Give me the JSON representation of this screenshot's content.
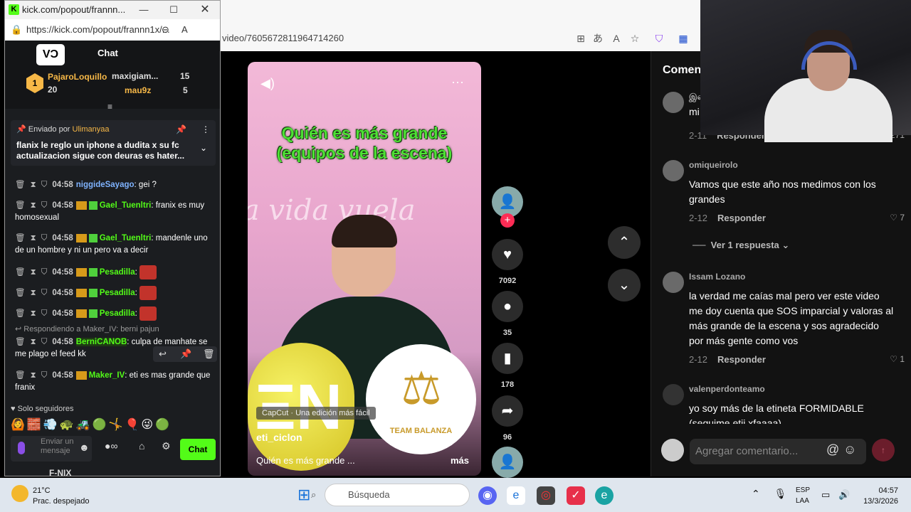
{
  "browser": {
    "url_fragment": "video/7605672811964714260"
  },
  "video": {
    "title_line1": "Quién es más grande",
    "title_line2": "(equipos de la escena)",
    "cursive_text": "la vida vuela",
    "capcut": "CapCut · Una edición más fácil",
    "author": "eti_ciclon",
    "description": "Quién es más grande ...",
    "more": "más",
    "logo_text": "TEAM BALANZA",
    "mute_icon": "speaker-icon",
    "more_icon": "ellipsis-icon"
  },
  "actions": {
    "likes": "7092",
    "comments": "35",
    "saves": "178",
    "shares": "96"
  },
  "comments_panel": {
    "title": "Comen",
    "items": [
      {
        "user": "இல",
        "text": "mi",
        "date": "2-11",
        "reply": "Responder",
        "likes": "271"
      },
      {
        "user": "omiqueirolo",
        "text": "Vamos que este año nos medimos con los grandes",
        "date": "2-12",
        "reply": "Responder",
        "likes": "7"
      },
      {
        "user": "Issam Lozano",
        "text": "la verdad me caías mal pero ver este video me doy cuenta que SOS imparcial y valoras al más grande de la escena y sos agradecido por más gente como vos",
        "date": "2-12",
        "reply": "Responder",
        "likes": "1"
      },
      {
        "user": "valenperdonteamo",
        "text": "yo soy más de la etineta FORMIDABLE (seguime etii xfaaaa)"
      }
    ],
    "view_replies": "Ver 1 respuesta",
    "input_placeholder": "Agregar comentario..."
  },
  "popout": {
    "window_title": "kick.com/popout/frannn...",
    "url": "https://kick.com/popout/frannn1x/...",
    "chat_label": "Chat",
    "leaderboard": {
      "first_name": "PajaroLoquillo",
      "first_count": "20",
      "second_name": "maxigiam...",
      "second_count": "15",
      "third_name": "mau9z",
      "third_count": "5"
    },
    "pinned": {
      "sent_by_label": "Enviado por",
      "sent_by_user": "Ulimanyaa",
      "text": "flanix le reglo un iphone a dudita x su fc actualizacion sigue con deuras es hater..."
    },
    "messages": [
      {
        "time": "04:58",
        "user": "niggideSayago",
        "color": "#7fb3ff",
        "text": ": gei ?"
      },
      {
        "time": "04:58",
        "user": "Gael_Tuenltri",
        "color": "#53fc18",
        "text": ": franix es muy homosexual"
      },
      {
        "time": "04:58",
        "user": "Gael_Tuenltri",
        "color": "#53fc18",
        "text": ": mandenle uno de un hombre y ni un pero va a decir"
      },
      {
        "time": "04:58",
        "user": "Pesadilla",
        "color": "#53fc18",
        "text": ":"
      },
      {
        "time": "04:58",
        "user": "Pesadilla",
        "color": "#53fc18",
        "text": ":"
      },
      {
        "time": "04:58",
        "user": "Pesadilla",
        "color": "#53fc18",
        "text": ":"
      },
      {
        "time": "04:58",
        "user": "BerniCANOB",
        "color": "#53fc18",
        "text": ": culpa de manhate se me plago el feed kk"
      },
      {
        "time": "04:58",
        "user": "Maker_IV",
        "color": "#53fc18",
        "text": ": eti es mas grande que franix"
      }
    ],
    "reply_context": "Respondiendo a Maker_IV: berni pajun",
    "followers_only": "Solo seguidores",
    "input_placeholder": "Enviar un mensaje",
    "chat_button": "Chat",
    "below_name": "F-NIX"
  },
  "taskbar": {
    "temperature": "21°C",
    "condition": "Prac. despejado",
    "search": "Búsqueda",
    "lang1": "ESP",
    "lang2": "LAA",
    "time": "04:57",
    "date": "13/3/2026"
  }
}
